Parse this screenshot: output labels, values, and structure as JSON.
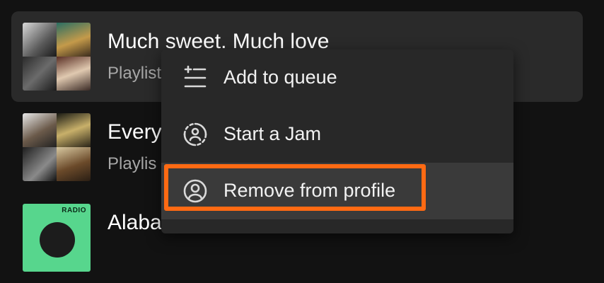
{
  "library": {
    "rows": [
      {
        "title": "Much sweet. Much love",
        "subtitle": "Playlist"
      },
      {
        "title": "Every",
        "subtitle": "Playlis"
      },
      {
        "title": "Alaba",
        "subtitle": ""
      }
    ],
    "row3_cover_badge": "RADIO"
  },
  "context_menu": {
    "items": [
      {
        "label": "Add to queue",
        "icon": "add-to-queue-icon"
      },
      {
        "label": "Start a Jam",
        "icon": "jam-icon"
      },
      {
        "label": "Remove from profile",
        "icon": "profile-icon"
      }
    ]
  },
  "colors": {
    "background": "#121212",
    "selected_row": "#2a2a2a",
    "menu_background": "#282828",
    "menu_hover": "#3a3a3a",
    "highlight": "#ff6a13",
    "secondary_text": "#a7a7a7",
    "radio_green": "#57d68d"
  }
}
